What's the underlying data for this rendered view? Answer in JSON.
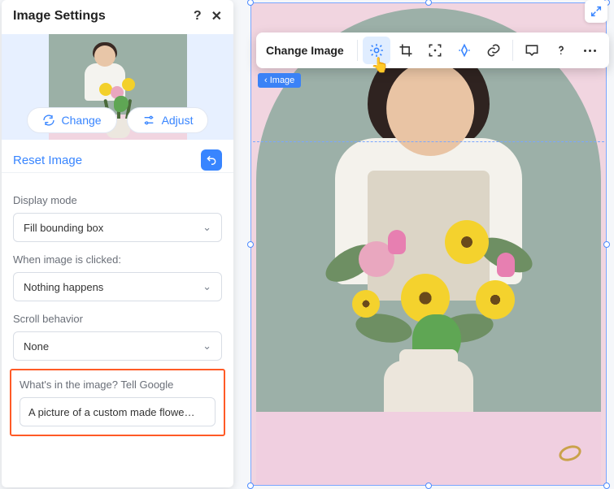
{
  "panel": {
    "title": "Image Settings",
    "help_icon": "?",
    "close_icon": "✕",
    "change_label": "Change",
    "adjust_label": "Adjust",
    "reset_label": "Reset Image",
    "display_mode": {
      "label": "Display mode",
      "value": "Fill bounding box"
    },
    "click_action": {
      "label": "When image is clicked:",
      "value": "Nothing happens"
    },
    "scroll": {
      "label": "Scroll behavior",
      "value": "None"
    },
    "alt_text": {
      "label": "What's in the image? Tell Google",
      "value": "A picture of a custom made flowe…"
    }
  },
  "toolbar": {
    "change_image": "Change Image"
  },
  "breadcrumb": {
    "label": "‹ Image"
  }
}
